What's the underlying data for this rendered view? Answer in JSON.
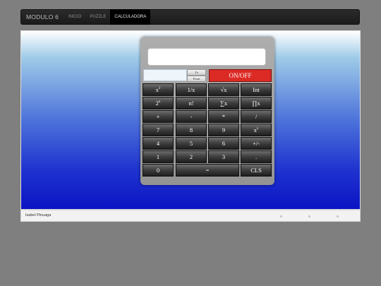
{
  "nav": {
    "brand": "MODULO 6",
    "links": [
      "INICIO",
      "PUZZLE",
      "CALCULADORA"
    ]
  },
  "calculator": {
    "display": "",
    "memory": "",
    "to_label": "To",
    "from_label": "From",
    "onoff_label": "ON/OFF",
    "keys": [
      [
        "x2",
        "1/x",
        "√x",
        "Int"
      ],
      [
        "2n",
        "n!",
        "∑x",
        "∏x"
      ],
      [
        "+",
        "-",
        "*",
        "/"
      ],
      [
        "7",
        "8",
        "9",
        "xy"
      ],
      [
        "4",
        "5",
        "6",
        "+/-"
      ],
      [
        "1",
        "2",
        "3",
        "."
      ],
      [
        "0",
        "=",
        "CLS"
      ]
    ]
  },
  "footer": {
    "author": "Isabel Pinuaga"
  },
  "colors": {
    "navbar": "#222222",
    "onoff": "#dc2a24",
    "background": "#7f7f7f",
    "gradient_top": "#ffffff",
    "gradient_bottom": "#0b14c4"
  }
}
